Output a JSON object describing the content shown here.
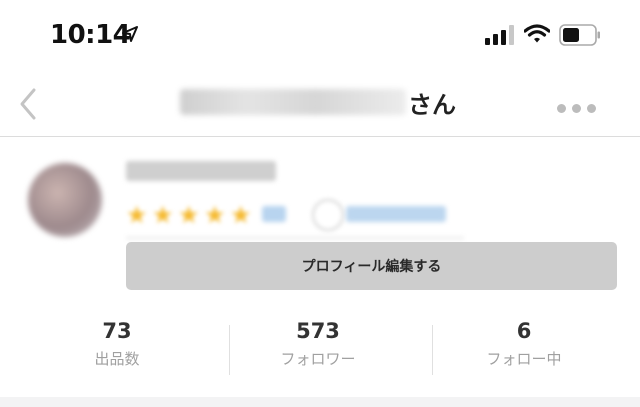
{
  "status_bar": {
    "time": "10:14",
    "icons": [
      "location-arrow-icon",
      "cellular-signal-icon",
      "wifi-icon",
      "battery-icon"
    ]
  },
  "nav": {
    "title_suffix": "さん",
    "back_icon": "chevron-left-icon",
    "more_icon": "more-dots-icon"
  },
  "profile": {
    "rating_stars": 5,
    "edit_button_label": "プロフィール編集する"
  },
  "stats": [
    {
      "value": "73",
      "label": "出品数"
    },
    {
      "value": "573",
      "label": "フォロワー"
    },
    {
      "value": "6",
      "label": "フォロー中"
    }
  ],
  "colors": {
    "star": "#f5b92e",
    "button_bg": "#cdcdcd",
    "divider": "#dcdcdc"
  }
}
